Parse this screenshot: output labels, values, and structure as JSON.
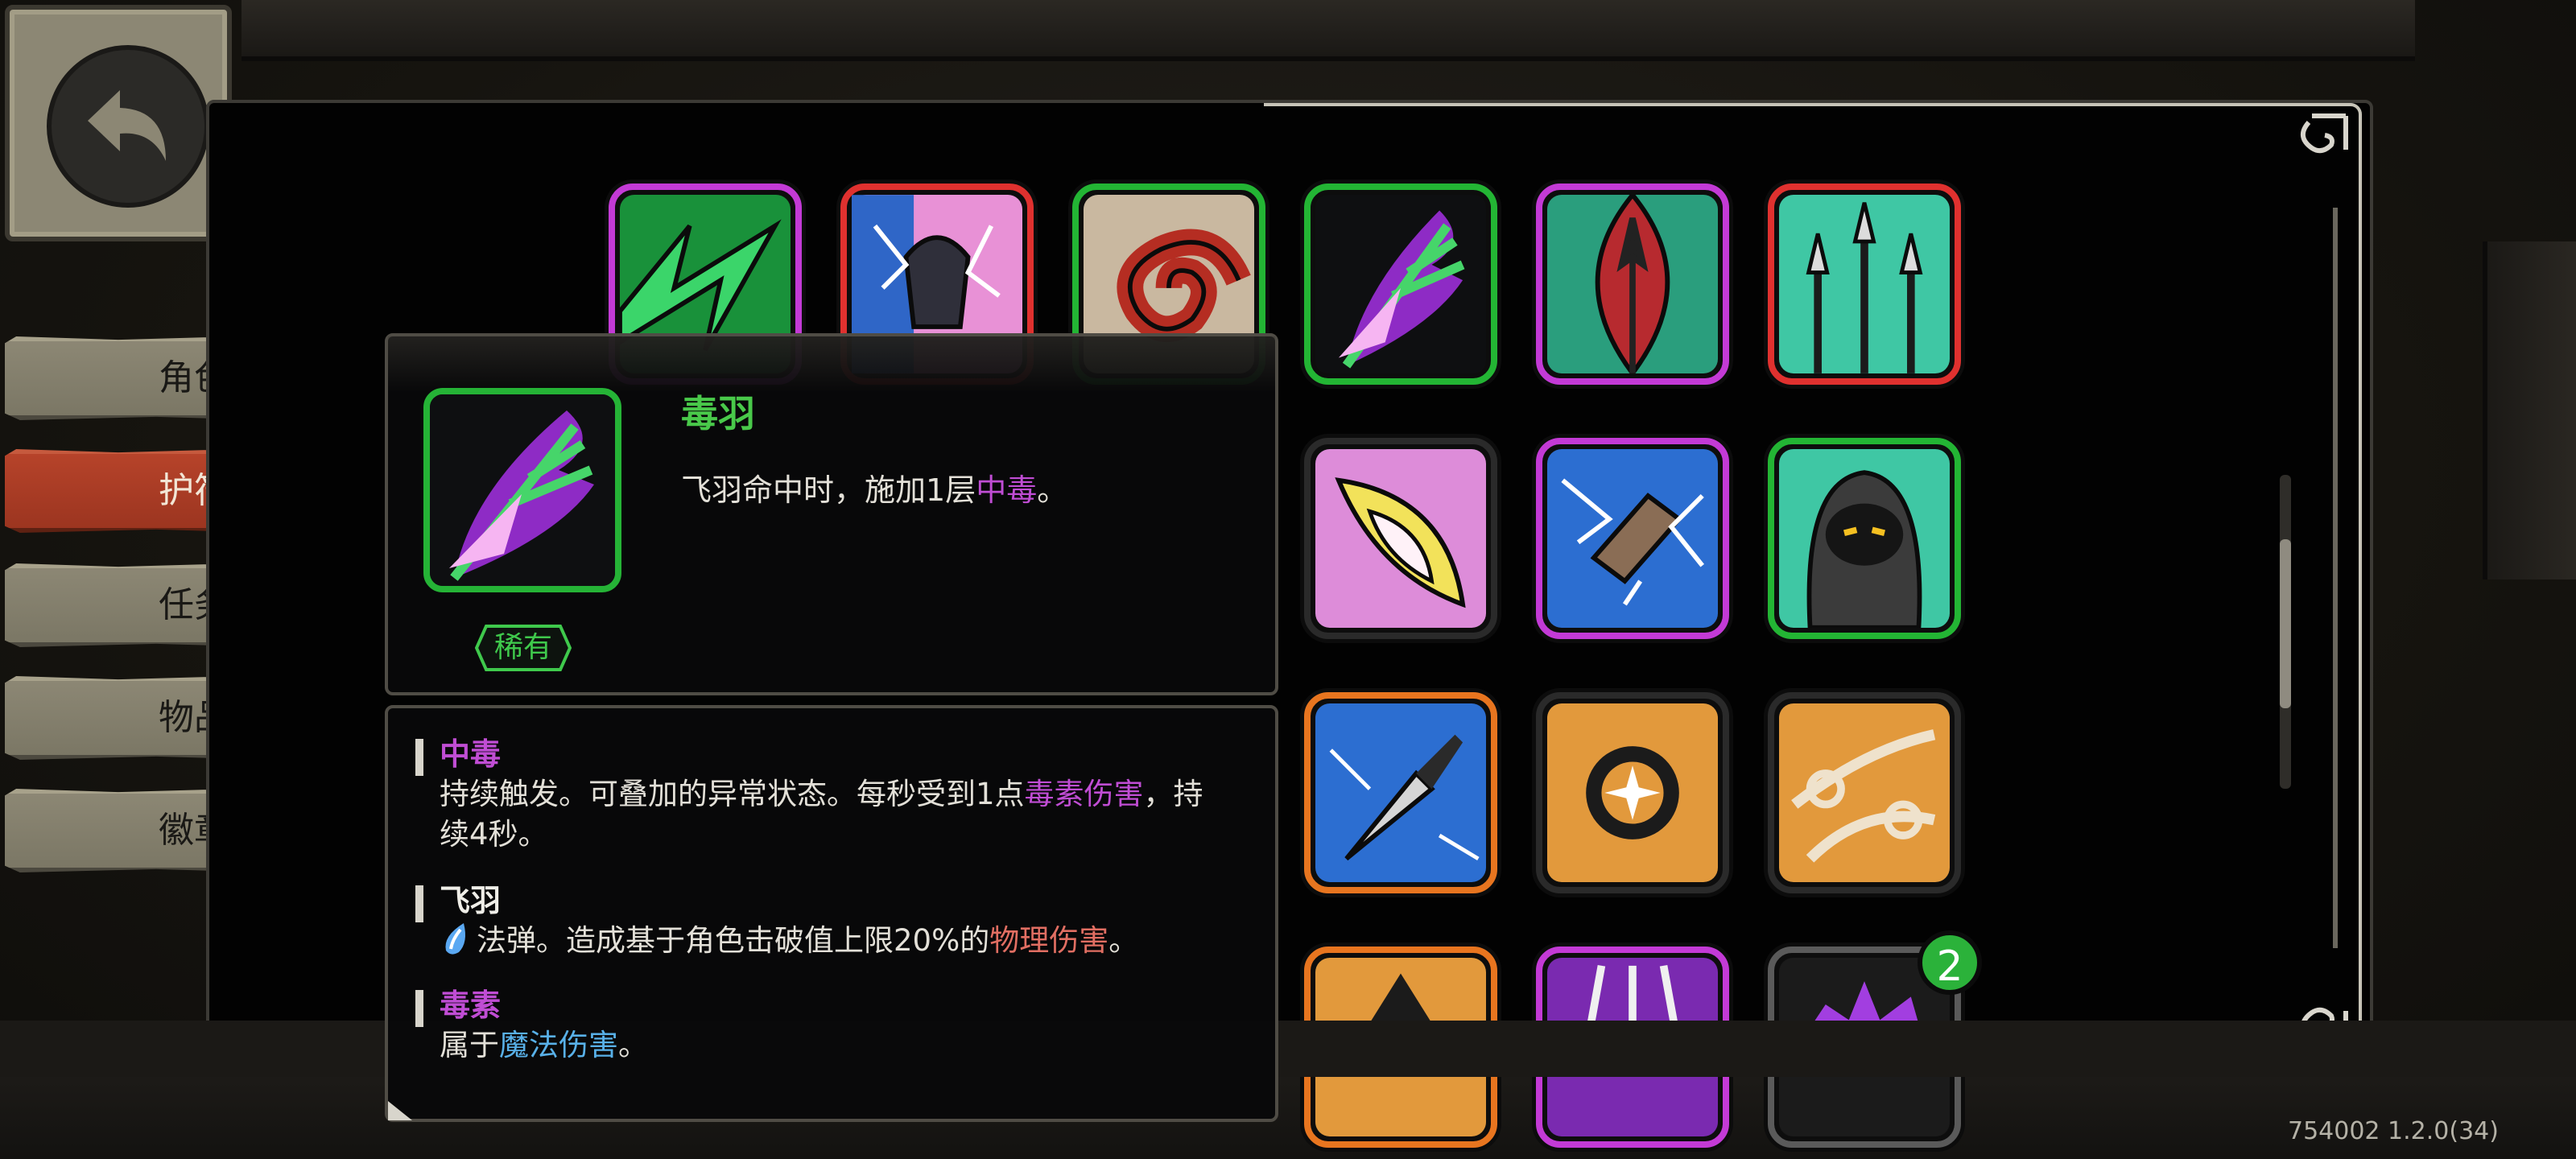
{
  "sidebar": {
    "tabs": [
      {
        "label": "角色",
        "active": false
      },
      {
        "label": "护符",
        "active": true
      },
      {
        "label": "任务",
        "active": false
      },
      {
        "label": "物品",
        "active": false
      },
      {
        "label": "徽章",
        "active": false
      }
    ]
  },
  "grid": {
    "cards": [
      {
        "name": "green-lightning",
        "rarity_color": "#c33ad6"
      },
      {
        "name": "electric-fist",
        "rarity_color": "#e0312f"
      },
      {
        "name": "red-swirl",
        "rarity_color": "#23b534"
      },
      {
        "name": "poison-feather",
        "rarity_color": "#23b534"
      },
      {
        "name": "red-spear",
        "rarity_color": "#c33ad6"
      },
      {
        "name": "triple-spears",
        "rarity_color": "#e0312f"
      },
      {
        "name": "golden-wing",
        "rarity_color": "#222222"
      },
      {
        "name": "lightning-crystal",
        "rarity_color": "#c33ad6"
      },
      {
        "name": "hooded-assassin",
        "rarity_color": "#23b534"
      },
      {
        "name": "blue-dagger",
        "rarity_color": "#e8751f"
      },
      {
        "name": "orange-shuriken",
        "rarity_color": "#222222"
      },
      {
        "name": "orange-chain",
        "rarity_color": "#222222"
      },
      {
        "name": "orange-spikes",
        "rarity_color": "#e8751f"
      },
      {
        "name": "purple-blades",
        "rarity_color": "#c33ad6"
      },
      {
        "name": "purple-burst",
        "rarity_color": "#5a5a5a"
      }
    ],
    "badge_count": "2"
  },
  "tooltip": {
    "title": "毒羽",
    "rarity": "稀有",
    "desc_prefix": "飞羽命中时，施加1层",
    "desc_keyword": "中毒",
    "desc_suffix": "。",
    "keywords": [
      {
        "title": "中毒",
        "line1_prefix": "持续触发。可叠加的异常状态。每秒受到1点",
        "line1_keyword": "毒素伤害",
        "line1_suffix": "，持",
        "line2": "续4秒。"
      },
      {
        "title": "飞羽",
        "prefix": "法弹。造成基于角色击破值上限20%的",
        "keyword": "物理伤害",
        "suffix": "。"
      },
      {
        "title": "毒素",
        "prefix": "属于",
        "keyword": "魔法伤害",
        "suffix": "。"
      }
    ]
  },
  "version": "754002 1.2.0(34)",
  "colors": {
    "green_rarity": "#3fc94c",
    "poison_purple": "#c04dd4",
    "physical_red": "#e16e62",
    "magic_blue": "#58b0e8",
    "active_tab": "#b6432a"
  }
}
